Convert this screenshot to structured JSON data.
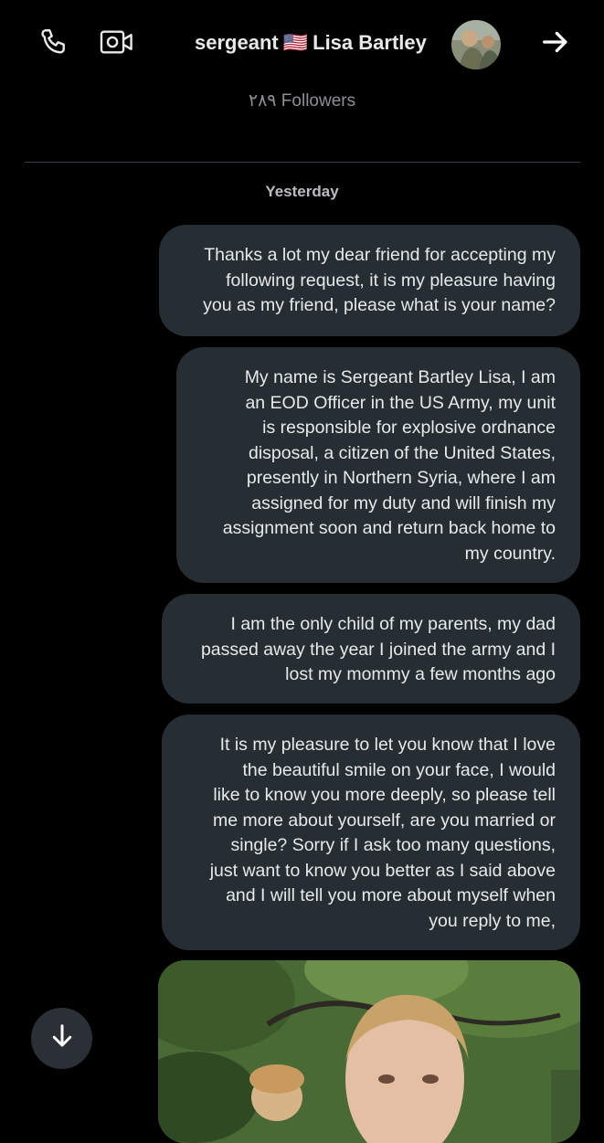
{
  "header": {
    "name_prefix": "sergeant",
    "flag": "🇺🇸",
    "name_suffix": "Lisa Bartley",
    "followers": "٢٨٩ Followers",
    "icons": [
      "phone-icon",
      "video-camera-icon",
      "arrow-right-icon"
    ]
  },
  "conversation": {
    "date_separator": "Yesterday",
    "messages": [
      {
        "text": "Thanks a lot my dear friend for accepting my\nfollowing request, it is  my pleasure having\nyou as my friend, please what is your name?"
      },
      {
        "text": "My  name is Sergeant Bartley Lisa, I am\nan EOD Officer  in the US Army,  my unit\nis responsible for explosive ordnance\ndisposal, a citizen of the United States,\npresently in Northern Syria,  where I am\nassigned for my duty and will finish my\nassignment soon and return back home to\nmy country."
      },
      {
        "text": "I am the only child of my parents, my dad\npassed away the year I joined the army and I\nlost my mommy a few months ago"
      },
      {
        "text": "It is my pleasure to let you know that I love\nthe beautiful smile on your  face, I would\nlike to know you more deeply, so please tell\nme more about yourself, are you married or\nsingle? Sorry if I ask too many questions,\njust want to know you  better as I said above\nand I will tell you more about myself when\nyou reply to me,"
      }
    ]
  },
  "scroll_button": {
    "icon": "arrow-down-icon"
  },
  "colors": {
    "background": "#000000",
    "bubble": "#262d33",
    "text": "#e7e9ea",
    "muted": "#8b9095"
  }
}
